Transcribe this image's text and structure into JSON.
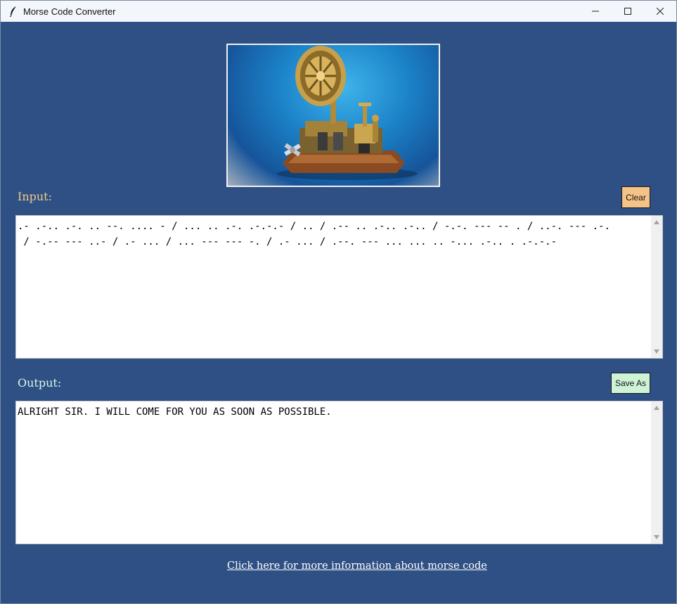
{
  "window": {
    "title": "Morse Code Converter",
    "icons": {
      "app": "feather-icon",
      "minimize": "minimize-icon",
      "maximize": "maximize-icon",
      "close": "close-icon"
    }
  },
  "image": {
    "icon": "telegraph-machine-image"
  },
  "input": {
    "label": "Input:",
    "clear_label": "Clear",
    "text": ".- .-.. .-. .. --. .... - / ... .. .-. .-.-.- / .. / .-- .. .-.. .-.. / -.-. --- -- . / ..-. --- .-.\n / -.-- --- ..- / .- ... / ... --- --- -. / .- ... / .--. --- ... ... .. -... .-.. . .-.-.-"
  },
  "output": {
    "label": "Output:",
    "save_label": "Save As",
    "text": "ALRIGHT SIR. I WILL COME FOR YOU AS SOON AS POSSIBLE."
  },
  "footer": {
    "link_text": "Click here for more information about morse code"
  },
  "colors": {
    "window_bg": "#2e5084",
    "input_label": "#f3c98b",
    "output_label": "#d9f7ea",
    "clear_button": "#f5c388",
    "save_button": "#cff3d6"
  }
}
